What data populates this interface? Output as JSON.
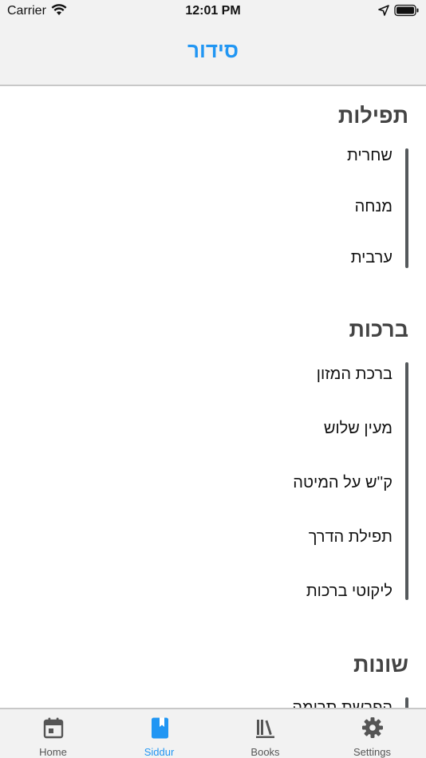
{
  "status_bar": {
    "carrier": "Carrier",
    "time": "12:01 PM"
  },
  "nav": {
    "title": "סידור"
  },
  "sections": [
    {
      "title": "תפילות",
      "items": [
        "שחרית",
        "מנחה",
        "ערבית"
      ]
    },
    {
      "title": "ברכות",
      "items": [
        "ברכת המזון",
        "מעין שלוש",
        "ק''ש על המיטה",
        "תפילת הדרך",
        "ליקוטי ברכות"
      ]
    },
    {
      "title": "שונות",
      "items": [
        "הפרשת תרומה"
      ]
    }
  ],
  "tabs": [
    {
      "label": "Home",
      "icon": "calendar-icon"
    },
    {
      "label": "Siddur",
      "icon": "book-icon",
      "active": true
    },
    {
      "label": "Books",
      "icon": "library-icon"
    },
    {
      "label": "Settings",
      "icon": "gear-icon"
    }
  ],
  "colors": {
    "accent": "#2196f3",
    "section_bar": "#55595c",
    "bar_background": "#f2f2f2"
  }
}
